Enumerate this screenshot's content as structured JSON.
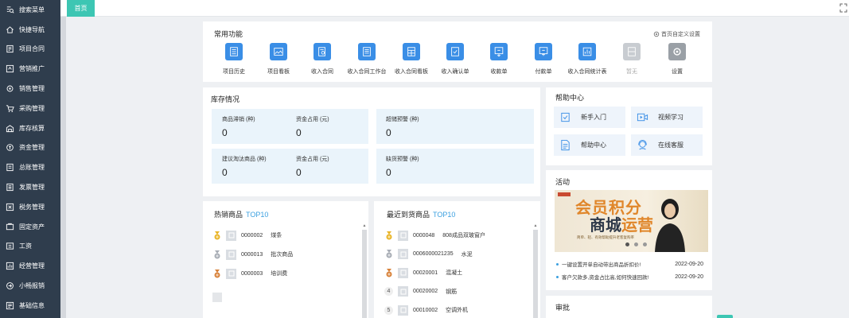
{
  "sidebar": {
    "items": [
      {
        "label": "搜索菜单",
        "icon": "search-menu-icon"
      },
      {
        "label": "快捷导航",
        "icon": "home-icon"
      },
      {
        "label": "项目合同",
        "icon": "contract-icon"
      },
      {
        "label": "营销推广",
        "icon": "megaphone-icon"
      },
      {
        "label": "销售管理",
        "icon": "gear-cog-icon"
      },
      {
        "label": "采购管理",
        "icon": "cart-icon"
      },
      {
        "label": "库存核算",
        "icon": "warehouse-icon"
      },
      {
        "label": "资金管理",
        "icon": "coin-icon"
      },
      {
        "label": "总账管理",
        "icon": "ledger-icon"
      },
      {
        "label": "发票管理",
        "icon": "invoice-icon"
      },
      {
        "label": "税务管理",
        "icon": "tax-icon"
      },
      {
        "label": "固定资产",
        "icon": "asset-icon"
      },
      {
        "label": "工资",
        "icon": "salary-icon"
      },
      {
        "label": "经营管理",
        "icon": "chart-icon"
      },
      {
        "label": "小畅报销",
        "icon": "reimburse-icon"
      },
      {
        "label": "基础信息",
        "icon": "info-icon"
      }
    ]
  },
  "tabs": {
    "home": "首页"
  },
  "common": {
    "title": "常用功能",
    "custom_link": "首页自定义设置",
    "items": [
      {
        "label": "项目历史",
        "icon": "history-doc-icon"
      },
      {
        "label": "项目看板",
        "icon": "image-board-icon"
      },
      {
        "label": "收入合同",
        "icon": "contract-search-icon"
      },
      {
        "label": "收入合同工作台",
        "icon": "list-doc-icon"
      },
      {
        "label": "收入合同看板",
        "icon": "grid-doc-icon"
      },
      {
        "label": "收入确认单",
        "icon": "check-doc-icon"
      },
      {
        "label": "收款单",
        "icon": "receipt-in-icon"
      },
      {
        "label": "付款单",
        "icon": "receipt-out-icon"
      },
      {
        "label": "收入合同统计表",
        "icon": "stats-doc-icon"
      },
      {
        "label": "暂无",
        "icon": "empty-icon"
      },
      {
        "label": "设置",
        "icon": "settings-icon"
      }
    ]
  },
  "inventory": {
    "title": "库存情况",
    "cells": [
      {
        "label": "商品滞销 (种)",
        "value": "0"
      },
      {
        "label": "资金占用 (元)",
        "value": "0"
      },
      {
        "label": "超储预警 (种)",
        "value": "0"
      },
      {
        "label": "建议淘汰商品 (种)",
        "value": "0"
      },
      {
        "label": "资金占用 (元)",
        "value": "0"
      },
      {
        "label": "缺货预警 (种)",
        "value": "0"
      }
    ]
  },
  "help": {
    "title": "帮助中心",
    "items": [
      {
        "label": "新手入门",
        "icon": "clipboard-check-icon"
      },
      {
        "label": "视频学习",
        "icon": "video-icon"
      },
      {
        "label": "帮助中心",
        "icon": "document-icon"
      },
      {
        "label": "在线客服",
        "icon": "customer-service-icon"
      }
    ]
  },
  "hot": {
    "title": "热销商品",
    "top": "TOP10",
    "rows": [
      {
        "rank": "1",
        "code": "0000002",
        "name": "煤条"
      },
      {
        "rank": "2",
        "code": "0000013",
        "name": "批次商品"
      },
      {
        "rank": "3",
        "code": "0000003",
        "name": "培训费"
      }
    ]
  },
  "recent": {
    "title": "最近到货商品",
    "top": "TOP10",
    "rows": [
      {
        "rank": "1",
        "code": "0000048",
        "name": "808成品双玻窗户"
      },
      {
        "rank": "2",
        "code": "0006000021235",
        "name": "水泥"
      },
      {
        "rank": "3",
        "code": "00020001",
        "name": "混凝土"
      },
      {
        "rank": "4",
        "code": "00020002",
        "name": "钢筋"
      },
      {
        "rank": "5",
        "code": "00010002",
        "name": "空调外机"
      }
    ]
  },
  "activity": {
    "title": "活动",
    "banner": {
      "line1": "会员积分",
      "line2a": "商城",
      "line2b": "运营",
      "sub": "简单、轻、有效帮助提升老客复购率"
    },
    "news": [
      {
        "text": "一键设置开单自动带出商品折扣价!",
        "date": "2022-09-20"
      },
      {
        "text": "客户欠款多,资金占比高,如何快速回款!",
        "date": "2022-09-20"
      }
    ]
  },
  "approval": {
    "title": "审批"
  },
  "colors": {
    "accent": "#3dc6b3",
    "sidebar": "#2f3d4d",
    "icon_blue": "#3a8ee6",
    "top10": "#3ba0e0"
  }
}
